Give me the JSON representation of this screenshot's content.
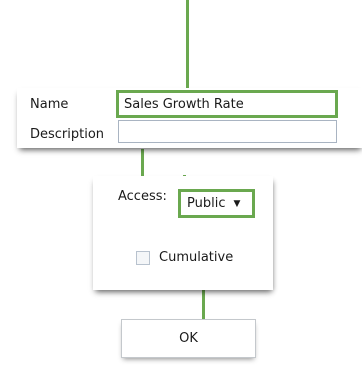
{
  "form": {
    "name_label": "Name",
    "name_value": "Sales Growth Rate",
    "description_label": "Description",
    "description_value": ""
  },
  "options": {
    "access_label": "Access:",
    "access_selected": "Public",
    "cumulative_label": "Cumulative",
    "cumulative_checked": false
  },
  "actions": {
    "ok_label": "OK"
  },
  "colors": {
    "highlight": "#6aa84f",
    "field_border": "#a9b4c2"
  }
}
